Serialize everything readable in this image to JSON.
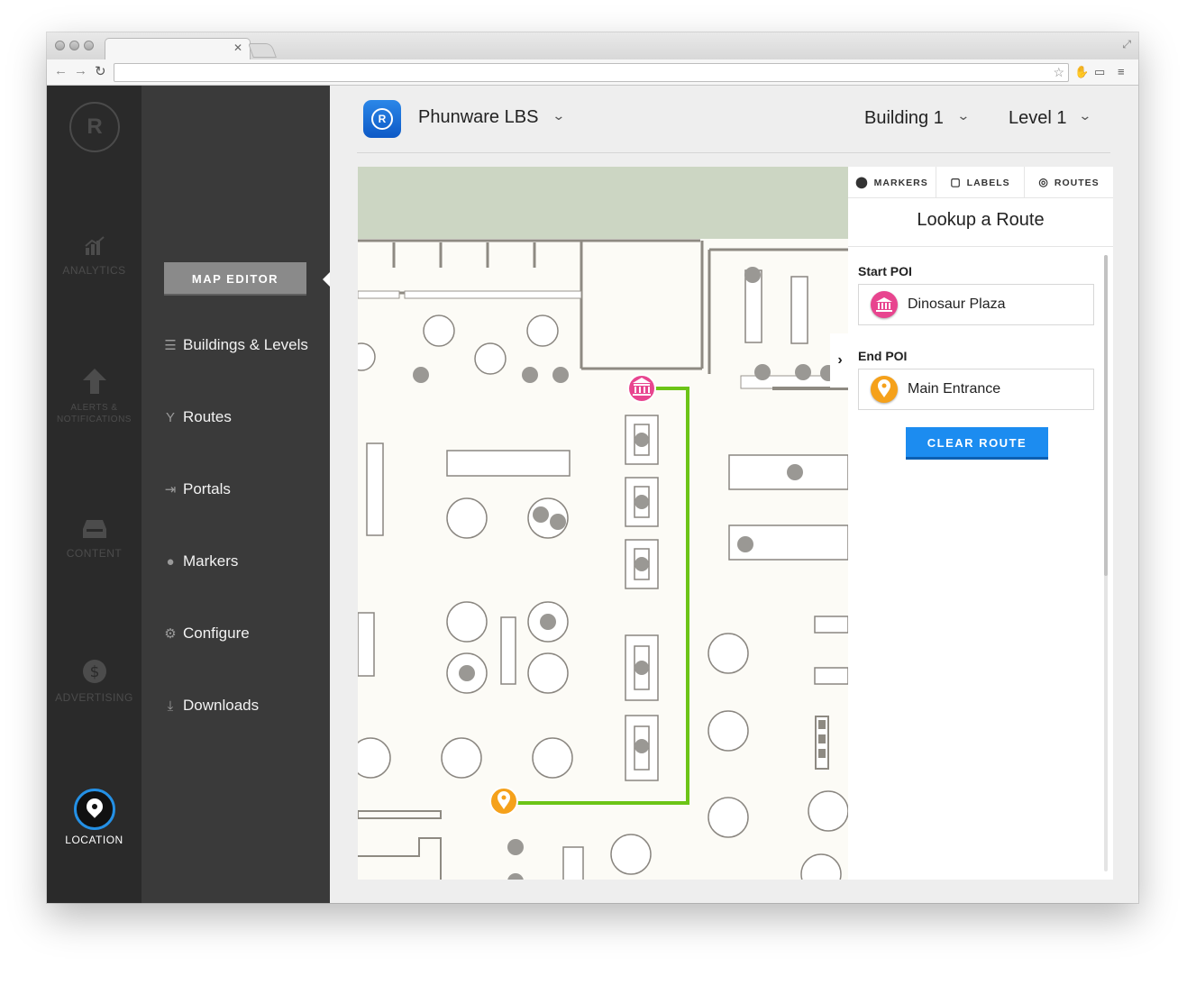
{
  "app": {
    "name": "Phunware LBS",
    "building": "Building 1",
    "level": "Level 1"
  },
  "leftnav": {
    "logo_letter": "R",
    "items": [
      {
        "label": "ANALYTICS",
        "icon": "chart-icon",
        "active": false
      },
      {
        "label": "ALERTS & NOTIFICATIONS",
        "icon": "arrow-up-icon",
        "active": false
      },
      {
        "label": "CONTENT",
        "icon": "inbox-icon",
        "active": false
      },
      {
        "label": "ADVERTISING",
        "icon": "dollar-icon",
        "active": false
      },
      {
        "label": "LOCATION",
        "icon": "location-pin-icon",
        "active": true
      }
    ]
  },
  "subnav": {
    "section_button": "MAP EDITOR",
    "items": [
      {
        "label": "Buildings & Levels",
        "icon": "layers-icon"
      },
      {
        "label": "Routes",
        "icon": "fork-icon"
      },
      {
        "label": "Portals",
        "icon": "portal-icon"
      },
      {
        "label": "Markers",
        "icon": "marker-icon"
      },
      {
        "label": "Configure",
        "icon": "gear-icon"
      },
      {
        "label": "Downloads",
        "icon": "download-icon"
      }
    ]
  },
  "panel": {
    "tabs": [
      {
        "label": "MARKERS",
        "icon": "marker-icon"
      },
      {
        "label": "LABELS",
        "icon": "speech-bubble-icon"
      },
      {
        "label": "ROUTES",
        "icon": "target-icon",
        "active": true
      }
    ],
    "title": "Lookup a Route",
    "start_label": "Start POI",
    "start_value": "Dinosaur Plaza",
    "end_label": "End POI",
    "end_value": "Main Entrance",
    "clear_button": "CLEAR ROUTE"
  },
  "colors": {
    "route": "#6cc417",
    "start_marker": "#e8458f",
    "end_marker": "#f5a11b",
    "accent": "#1c8cf0"
  }
}
